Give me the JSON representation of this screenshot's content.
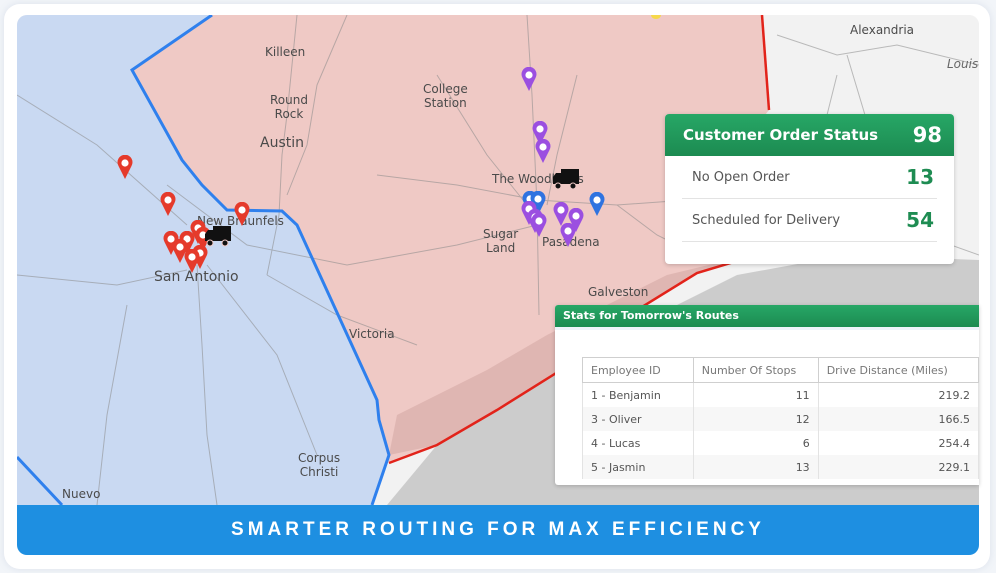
{
  "map": {
    "regions": [
      {
        "name": "west-territory",
        "fill": "#c9d9f2",
        "border": "#2f80ed"
      },
      {
        "name": "east-territory",
        "fill": "#efc9c5",
        "border": "#e2231a"
      }
    ],
    "cities": {
      "killeen": "Killeen",
      "round_rock_1": "Round",
      "round_rock_2": "Rock",
      "austin": "Austin",
      "college_station_1": "College",
      "college_station_2": "Station",
      "new_braunfels": "New Braunfels",
      "san_antonio": "San Antonio",
      "the_woodlands": "The Woodlands",
      "sugar_land_1": "Sugar",
      "sugar_land_2": "Land",
      "pasadena": "Pasadena",
      "galveston": "Galveston",
      "victoria": "Victoria",
      "corpus_christi_1": "Corpus",
      "corpus_christi_2": "Christi",
      "nuevo": "Nuevo",
      "alexandria": "Alexandria",
      "louisiana": "Louis"
    },
    "pin_colors": {
      "red": "#e53a2b",
      "purple": "#9b4fe0",
      "blue": "#2f73e0"
    }
  },
  "order_status": {
    "title": "Customer Order Status",
    "total": "98",
    "rows": [
      {
        "label": "No Open Order",
        "value": "13"
      },
      {
        "label": "Scheduled for Delivery",
        "value": "54"
      }
    ]
  },
  "routes": {
    "title": "Stats for Tomorrow's Routes",
    "columns": [
      "Employee ID",
      "Number Of Stops",
      "Drive Distance (Miles)"
    ],
    "rows": [
      {
        "employee": "1 - Benjamin",
        "stops": "11",
        "distance": "219.2"
      },
      {
        "employee": "3 - Oliver",
        "stops": "12",
        "distance": "166.5"
      },
      {
        "employee": "4 - Lucas",
        "stops": "6",
        "distance": "254.4"
      },
      {
        "employee": "5 - Jasmin",
        "stops": "13",
        "distance": "229.1"
      }
    ]
  },
  "banner": {
    "text": "SMARTER ROUTING FOR MAX EFFICIENCY"
  }
}
